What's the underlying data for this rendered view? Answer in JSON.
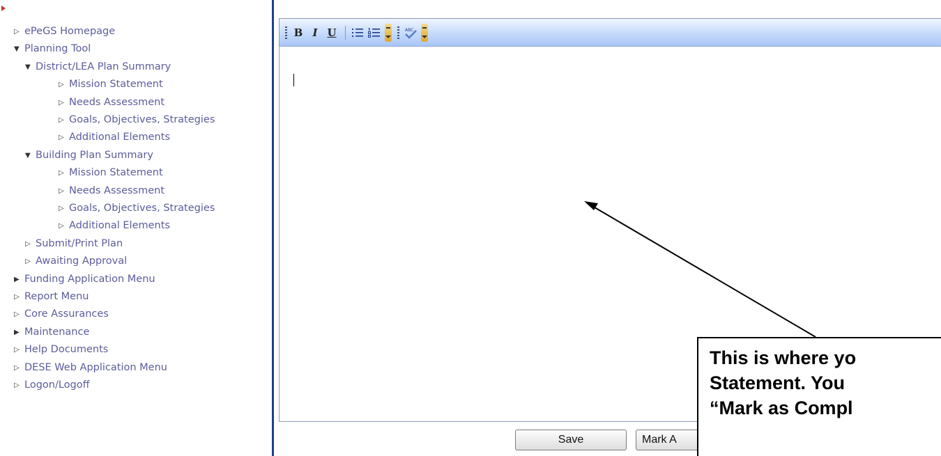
{
  "sidebar": {
    "items": [
      {
        "label": "ePeGS Homepage",
        "icon": "hollow-triangle-right-icon",
        "expanded": false,
        "indent": 0
      },
      {
        "label": "Planning Tool",
        "icon": "triangle-down-icon",
        "expanded": true,
        "indent": 0
      },
      {
        "label": "District/LEA Plan Summary",
        "icon": "triangle-down-icon",
        "expanded": true,
        "indent": 1
      },
      {
        "label": "Mission Statement",
        "icon": "hollow-triangle-right-icon",
        "expanded": false,
        "indent": 2
      },
      {
        "label": "Needs Assessment",
        "icon": "hollow-triangle-right-icon",
        "expanded": false,
        "indent": 2
      },
      {
        "label": "Goals, Objectives, Strategies",
        "icon": "hollow-triangle-right-icon",
        "expanded": false,
        "indent": 2
      },
      {
        "label": "Additional Elements",
        "icon": "hollow-triangle-right-icon",
        "expanded": false,
        "indent": 2
      },
      {
        "label": "Building Plan Summary",
        "icon": "triangle-down-icon",
        "expanded": true,
        "indent": 1
      },
      {
        "label": "Mission Statement",
        "icon": "hollow-triangle-right-icon",
        "expanded": false,
        "indent": 2
      },
      {
        "label": "Needs Assessment",
        "icon": "hollow-triangle-right-icon",
        "expanded": false,
        "indent": 2
      },
      {
        "label": "Goals, Objectives, Strategies",
        "icon": "hollow-triangle-right-icon",
        "expanded": false,
        "indent": 2
      },
      {
        "label": "Additional Elements",
        "icon": "hollow-triangle-right-icon",
        "expanded": false,
        "indent": 2
      },
      {
        "label": "Submit/Print Plan",
        "icon": "hollow-triangle-right-icon",
        "expanded": false,
        "indent": 1
      },
      {
        "label": "Awaiting Approval",
        "icon": "hollow-triangle-right-icon",
        "expanded": false,
        "indent": 1
      },
      {
        "label": "Funding Application Menu",
        "icon": "filled-triangle-right-icon",
        "expanded": false,
        "indent": 0
      },
      {
        "label": "Report Menu",
        "icon": "hollow-triangle-right-icon",
        "expanded": false,
        "indent": 0
      },
      {
        "label": "Core Assurances",
        "icon": "hollow-triangle-right-icon",
        "expanded": false,
        "indent": 0
      },
      {
        "label": "Maintenance",
        "icon": "filled-triangle-right-icon",
        "expanded": false,
        "indent": 0
      },
      {
        "label": "Help Documents",
        "icon": "hollow-triangle-right-icon",
        "expanded": false,
        "indent": 0
      },
      {
        "label": "DESE Web Application Menu",
        "icon": "hollow-triangle-right-icon",
        "expanded": false,
        "indent": 0
      },
      {
        "label": "Logon/Logoff",
        "icon": "hollow-triangle-right-icon",
        "expanded": false,
        "indent": 0
      }
    ]
  },
  "toolbar": {
    "bold": "B",
    "italic": "I",
    "underline": "U",
    "tools": [
      "bold-icon",
      "italic-icon",
      "underline-icon",
      "bulleted-list-icon",
      "numbered-list-icon",
      "spellcheck-icon"
    ]
  },
  "buttons": {
    "save_label": "Save",
    "mark_label": "Mark A"
  },
  "callout": {
    "line1": "This is where yo",
    "line2": "Statement.  You",
    "line3": "“Mark as Compl"
  },
  "colors": {
    "link": "#5c5c9c",
    "divider": "#1f3f8f",
    "toolbar_top": "#eef5ff",
    "toolbar_bottom": "#a9c6f4"
  }
}
